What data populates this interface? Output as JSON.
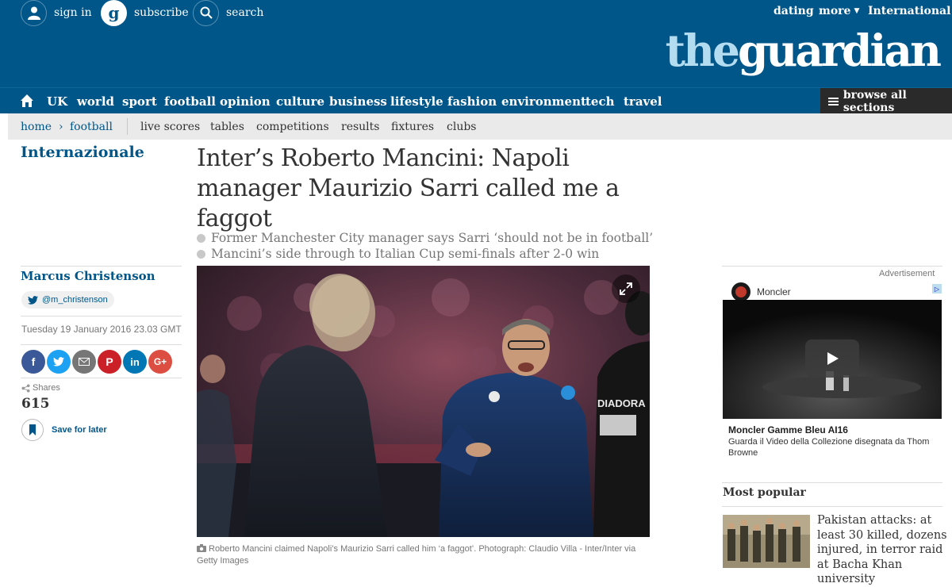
{
  "header": {
    "sign_in": "sign in",
    "subscribe": "subscribe",
    "search": "search",
    "dating": "dating",
    "more": "more",
    "edition": "International",
    "logo_the": "the",
    "logo_guardian": "guardian"
  },
  "nav": {
    "items": [
      "UK",
      "world",
      "sport",
      "football",
      "opinion",
      "culture",
      "business",
      "lifestyle",
      "fashion",
      "environment",
      "tech",
      "travel"
    ],
    "browse": "browse all sections"
  },
  "subnav": {
    "home": "home",
    "sep": "›",
    "football": "football",
    "links": [
      "live scores",
      "tables",
      "competitions",
      "results",
      "fixtures",
      "clubs"
    ]
  },
  "article": {
    "kicker": "Internazionale",
    "headline": "Inter’s Roberto Mancini: Napoli manager Maurizio Sarri called me a faggot",
    "standfirst": [
      "Former Manchester City manager says Sarri ‘should not be in football’",
      "Mancini’s side through to Italian Cup semi-finals after 2-0 win"
    ],
    "author": "Marcus Christenson",
    "twitter": "@m_christenson",
    "date": "Tuesday 19 January 2016 23.03 GMT",
    "share_icons": [
      "facebook-icon",
      "twitter-icon",
      "email-icon",
      "pinterest-icon",
      "linkedin-icon",
      "googleplus-icon"
    ],
    "shares_label": "Shares",
    "shares_count": "615",
    "save_label": "Save for later",
    "caption": "Roberto Mancini claimed Napoli’s Maurizio Sarri called him ‘a faggot’. Photograph: Claudio Villa - Inter/Inter via Getty Images"
  },
  "advert": {
    "label": "Advertisement",
    "brand": "Moncler",
    "title": "Moncler Gamme Bleu AI16",
    "description": "Guarda il Video della Collezione disegnata da Thom Browne"
  },
  "most_popular": {
    "title": "Most popular",
    "item": "Pakistan attacks: at least 30 killed, dozens injured, in terror raid at Bacha Khan university"
  },
  "colors": {
    "brand_blue": "#005689",
    "facebook": "#3b5998",
    "twitter": "#1da1f2",
    "email": "#767676",
    "pinterest": "#cb2027",
    "linkedin": "#0077b5",
    "googleplus": "#dc4e41"
  }
}
